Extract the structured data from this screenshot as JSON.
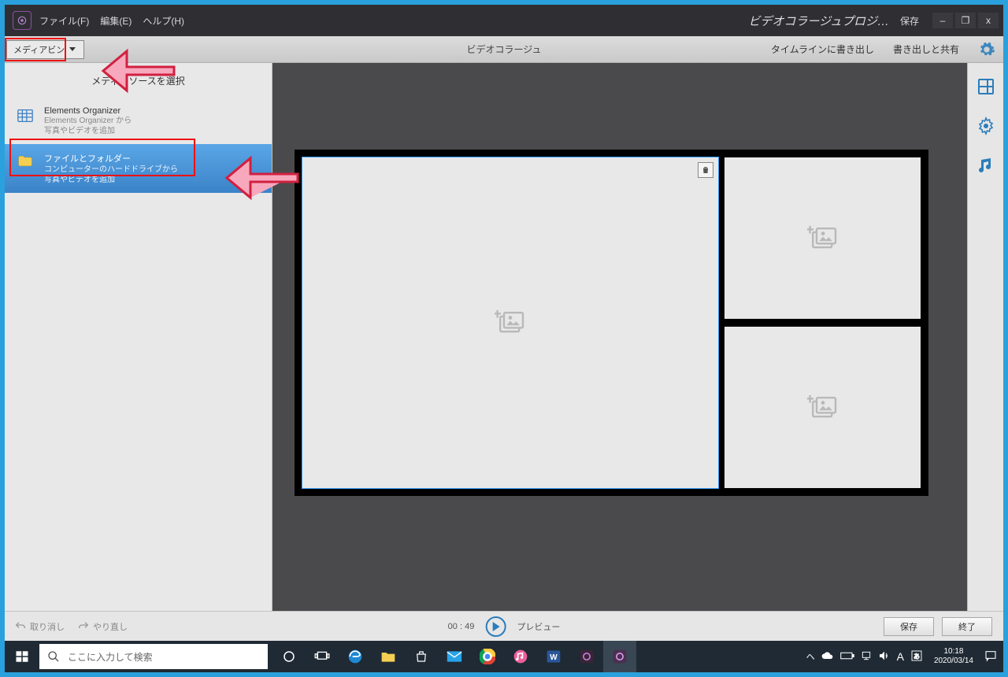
{
  "menu": {
    "file": "ファイル(F)",
    "edit": "編集(E)",
    "help": "ヘルプ(H)"
  },
  "project_title": "ビデオコラージュプロジ…",
  "save_top": "保存",
  "win": {
    "min": "–",
    "max": "❐",
    "close": "x"
  },
  "toolbar": {
    "media_bin": "メディアビン",
    "center_title": "ビデオコラージュ",
    "export_timeline": "タイムラインに書き出し",
    "export_share": "書き出しと共有"
  },
  "left": {
    "header": "メディアソースを選択",
    "item1": {
      "title": "Elements Organizer",
      "line1": "Elements Organizer から",
      "line2": "写真やビデオを追加"
    },
    "item2": {
      "title": "ファイルとフォルダー",
      "line1": "コンピューターのハードドライブから",
      "line2": "写真やビデオを追加"
    }
  },
  "footer": {
    "undo": "取り消し",
    "redo": "やり直し",
    "time": "00 : 49",
    "preview": "プレビュー",
    "save": "保存",
    "done": "終了"
  },
  "taskbar": {
    "search_placeholder": "ここに入力して検索",
    "time": "10:18",
    "date": "2020/03/14"
  }
}
